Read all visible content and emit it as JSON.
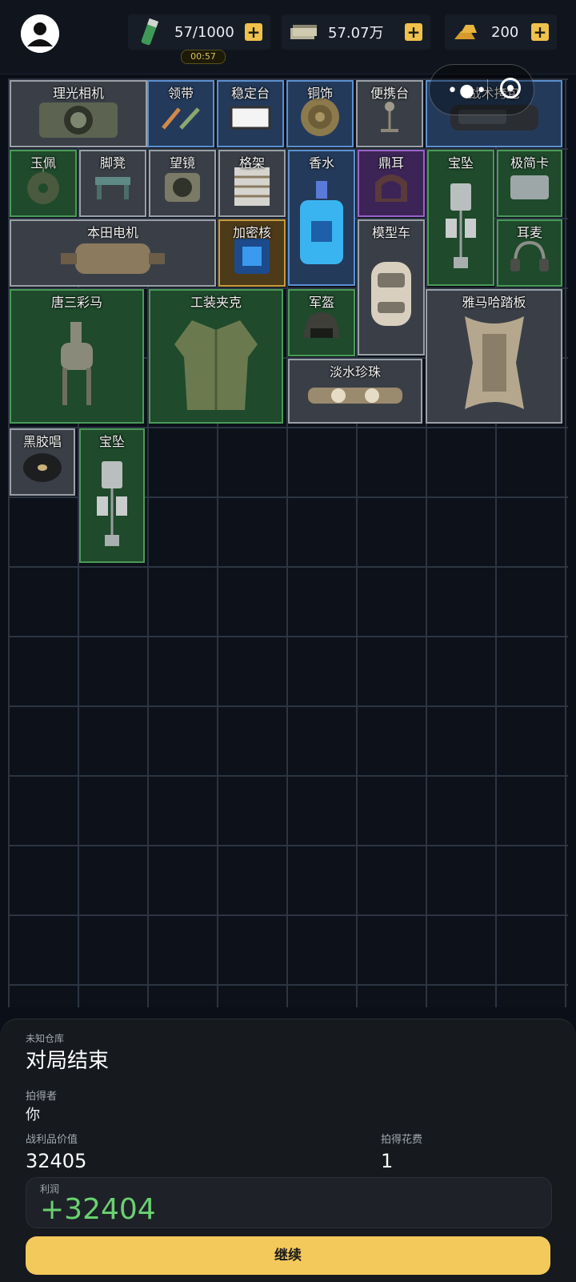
{
  "header": {
    "energy": "57/1000",
    "money": "57.07万",
    "gold": "200",
    "timer": "00:57"
  },
  "items": [
    {
      "name": "理光相机",
      "rarity": "gray",
      "icon": "camera-icon"
    },
    {
      "name": "领带",
      "rarity": "blue",
      "icon": "tie-icon"
    },
    {
      "name": "稳定台",
      "rarity": "blue",
      "icon": "stabilizer-icon"
    },
    {
      "name": "铜饰",
      "rarity": "blue",
      "icon": "bronze-ornament-icon"
    },
    {
      "name": "便携台",
      "rarity": "gray",
      "icon": "portable-stand-icon"
    },
    {
      "name": "战术挎包",
      "rarity": "blue",
      "icon": "tactical-bag-icon"
    },
    {
      "name": "玉佩",
      "rarity": "green",
      "icon": "jade-pendant-icon"
    },
    {
      "name": "脚凳",
      "rarity": "gray",
      "icon": "footstool-icon"
    },
    {
      "name": "望镜",
      "rarity": "gray",
      "icon": "telescope-icon"
    },
    {
      "name": "格架",
      "rarity": "gray",
      "icon": "shelf-icon"
    },
    {
      "name": "香水",
      "rarity": "blue",
      "icon": "perfume-icon"
    },
    {
      "name": "鼎耳",
      "rarity": "purple",
      "icon": "cauldron-ear-icon"
    },
    {
      "name": "宝坠",
      "rarity": "green",
      "icon": "pendant-icon"
    },
    {
      "name": "极简卡",
      "rarity": "green",
      "icon": "card-holder-icon"
    },
    {
      "name": "本田电机",
      "rarity": "gray",
      "icon": "motor-icon"
    },
    {
      "name": "加密核",
      "rarity": "gold",
      "icon": "crypto-core-icon"
    },
    {
      "name": "模型车",
      "rarity": "gray",
      "icon": "model-car-icon"
    },
    {
      "name": "耳麦",
      "rarity": "green",
      "icon": "headset-icon"
    },
    {
      "name": "唐三彩马",
      "rarity": "green",
      "icon": "horse-statue-icon"
    },
    {
      "name": "工装夹克",
      "rarity": "green",
      "icon": "jacket-icon"
    },
    {
      "name": "军盔",
      "rarity": "green",
      "icon": "helmet-icon"
    },
    {
      "name": "雅马哈踏板",
      "rarity": "gray",
      "icon": "pedal-board-icon"
    },
    {
      "name": "淡水珍珠",
      "rarity": "gray",
      "icon": "pearl-necklace-icon"
    },
    {
      "name": "黑胶唱",
      "rarity": "gray",
      "icon": "vinyl-record-icon"
    },
    {
      "name": "宝坠",
      "rarity": "green",
      "icon": "pendant-icon"
    }
  ],
  "result": {
    "warehouse": "未知仓库",
    "status": "对局结束",
    "winner_label": "拍得者",
    "winner": "你",
    "loot_label": "战利品价值",
    "loot_value": "32405",
    "cost_label": "拍得花费",
    "cost_value": "1",
    "profit_label": "利润",
    "profit_value": "+32404",
    "continue_label": "继续"
  },
  "colors": {
    "accent": "#f4c95b",
    "profit": "#6ad171",
    "gray": "#9aa0a8",
    "blue": "#5b8fd0",
    "green": "#4a9a58",
    "purple": "#9a63c9",
    "gold": "#c89b3c"
  }
}
